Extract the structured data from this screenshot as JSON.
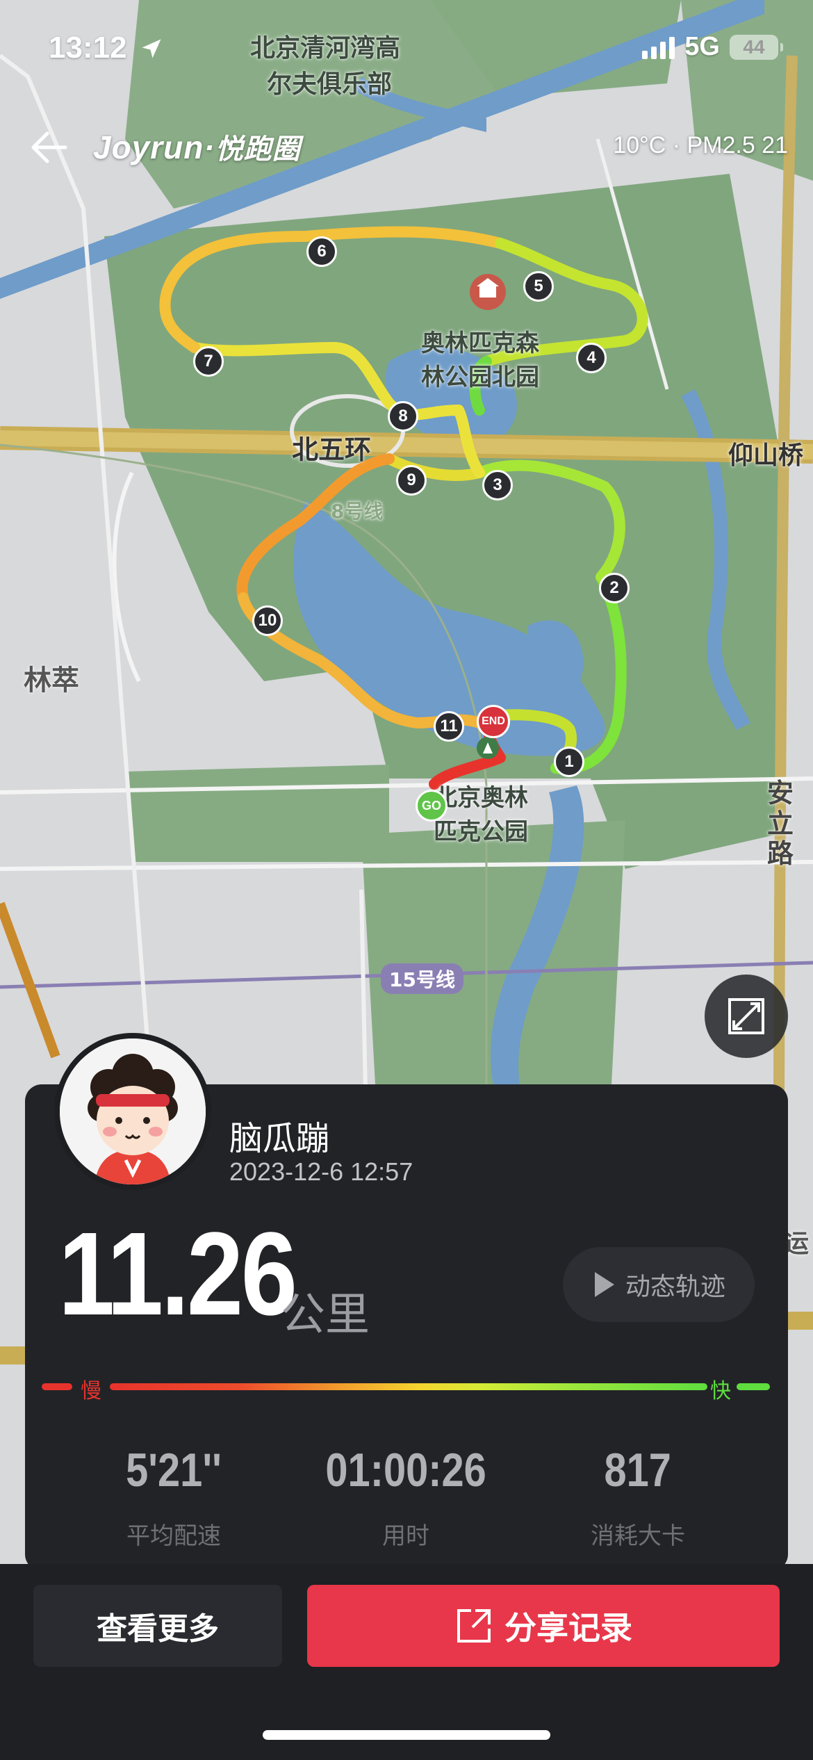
{
  "status_bar": {
    "time": "13:12",
    "network": "5G",
    "battery": "44"
  },
  "header": {
    "brand": "Joyrun·",
    "brand_cn": "悦跑圈",
    "weather": "10°C · PM2.5 21"
  },
  "map": {
    "labels": {
      "golf_club_line1": "北京清河湾高",
      "golf_club_line2": "尔夫俱乐部",
      "forest_park_line1": "奥林匹克森",
      "forest_park_line2": "林公园北园",
      "ring_road": "北五环",
      "bridge": "仰山桥",
      "subway_8": "8号线",
      "district": "林萃",
      "olympic_park_line1": "北京奥林",
      "olympic_park_line2": "匹克公园",
      "subway_15": "15号线",
      "anli_road": "安立路",
      "edge_text": "运"
    },
    "km_markers": [
      "1",
      "2",
      "3",
      "4",
      "5",
      "6",
      "7",
      "8",
      "9",
      "10",
      "11"
    ],
    "start_label": "GO",
    "end_label": "END"
  },
  "profile": {
    "username": "脑瓜蹦",
    "datetime": "2023-12-6 12:57"
  },
  "summary": {
    "distance": "11.26",
    "distance_unit": "公里",
    "replay_label": "动态轨迹",
    "speed_slow": "慢",
    "speed_fast": "快"
  },
  "stats": [
    {
      "value": "5'21''",
      "label": "平均配速"
    },
    {
      "value": "01:00:26",
      "label": "用时"
    },
    {
      "value": "817",
      "label": "消耗大卡"
    }
  ],
  "actions": {
    "more_label": "查看更多",
    "share_label": "分享记录"
  },
  "colors": {
    "slow": "#e8332c",
    "fast": "#5fdd3e",
    "share": "#e8374a",
    "card": "#222327"
  }
}
